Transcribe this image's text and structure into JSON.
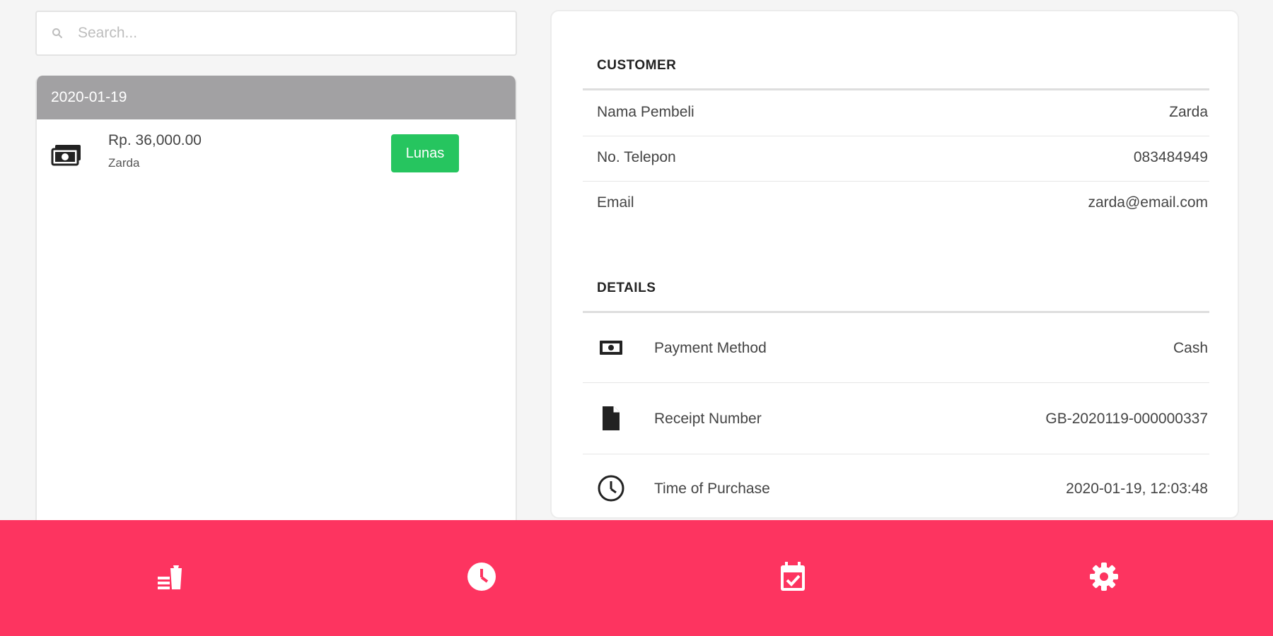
{
  "search": {
    "placeholder": "Search..."
  },
  "transactions": {
    "date_header": "2020-01-19",
    "items": [
      {
        "amount": "Rp. 36,000.00",
        "name": "Zarda",
        "status": "Lunas",
        "icon": "money-icon"
      }
    ]
  },
  "customer": {
    "title": "CUSTOMER",
    "rows": [
      {
        "label": "Nama Pembeli",
        "value": "Zarda"
      },
      {
        "label": "No. Telepon",
        "value": "083484949"
      },
      {
        "label": "Email",
        "value": "zarda@email.com"
      }
    ]
  },
  "details": {
    "title": "DETAILS",
    "rows": [
      {
        "icon": "cash-icon",
        "label": "Payment Method",
        "value": "Cash"
      },
      {
        "icon": "receipt-icon",
        "label": "Receipt Number",
        "value": "GB-2020119-000000337"
      },
      {
        "icon": "clock-icon",
        "label": "Time of Purchase",
        "value": "2020-01-19, 12:03:48"
      }
    ]
  },
  "bottom_nav": {
    "items": [
      {
        "icon": "food-drink-icon"
      },
      {
        "icon": "history-clock-icon"
      },
      {
        "icon": "calendar-check-icon"
      },
      {
        "icon": "settings-gear-icon"
      }
    ]
  },
  "colors": {
    "accent": "#fd3460",
    "success": "#26c55f",
    "header_gray": "#a2a1a3"
  }
}
